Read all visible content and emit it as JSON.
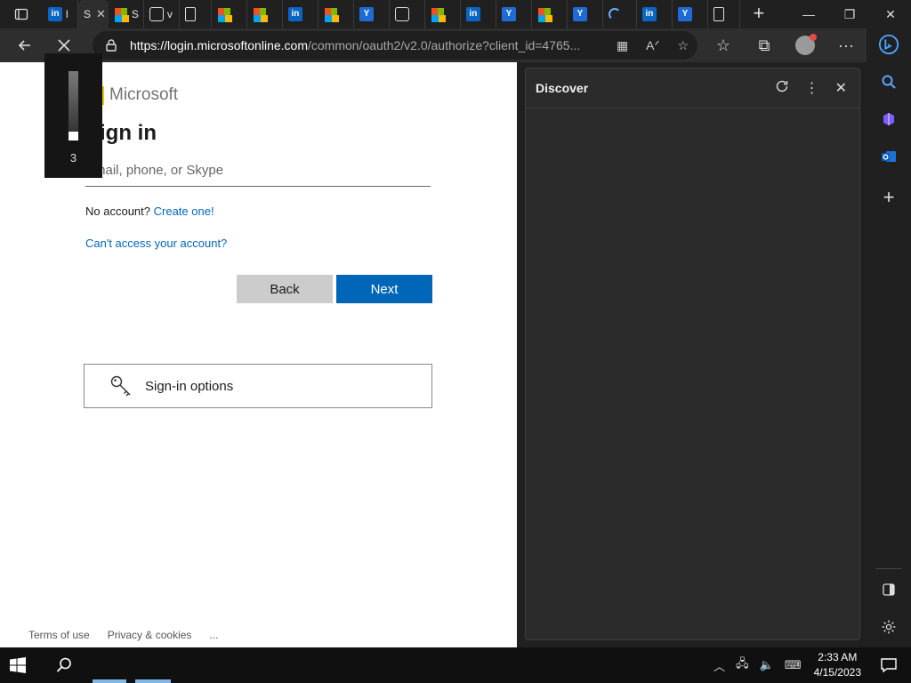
{
  "browser": {
    "tabs": [
      {
        "icon": "linkedin-icon",
        "label": "l"
      },
      {
        "icon": "page-icon",
        "label": "S",
        "active": true
      },
      {
        "icon": "microsoft-icon",
        "label": "S"
      },
      {
        "icon": "bag-icon",
        "label": "v"
      },
      {
        "icon": "document-icon",
        "label": ""
      },
      {
        "icon": "microsoft-icon",
        "label": ""
      },
      {
        "icon": "microsoft-icon",
        "label": ""
      },
      {
        "icon": "linkedin-icon",
        "label": ""
      },
      {
        "icon": "microsoft-icon",
        "label": ""
      },
      {
        "icon": "yahoo-icon",
        "label": ""
      },
      {
        "icon": "bag-icon",
        "label": ""
      },
      {
        "icon": "microsoft-icon",
        "label": ""
      },
      {
        "icon": "linkedin-icon",
        "label": ""
      },
      {
        "icon": "yahoo-icon",
        "label": ""
      },
      {
        "icon": "microsoft-icon",
        "label": ""
      },
      {
        "icon": "yahoo-icon",
        "label": ""
      },
      {
        "icon": "loading-icon",
        "label": ""
      },
      {
        "icon": "linkedin-icon",
        "label": ""
      },
      {
        "icon": "yahoo-icon",
        "label": ""
      },
      {
        "icon": "document-icon",
        "label": ""
      }
    ],
    "url_domain": "https://login.microsoftonline.com",
    "url_path": "/common/oauth2/v2.0/authorize?client_id=4765..."
  },
  "page": {
    "brand": "Microsoft",
    "title": "Sign in",
    "email_placeholder": "Email, phone, or Skype",
    "no_account_text": "No account?",
    "create_link": "Create one!",
    "cant_access": "Can't access your account?",
    "back_label": "Back",
    "next_label": "Next",
    "signin_options": "Sign-in options",
    "footer": {
      "terms": "Terms of use",
      "privacy": "Privacy & cookies",
      "more": "..."
    }
  },
  "overlay": {
    "value": "3"
  },
  "discover": {
    "title": "Discover"
  },
  "taskbar": {
    "time": "2:33 AM",
    "date": "4/15/2023"
  },
  "colors": {
    "accent": "#0067b8",
    "browser_bg": "#202020"
  }
}
